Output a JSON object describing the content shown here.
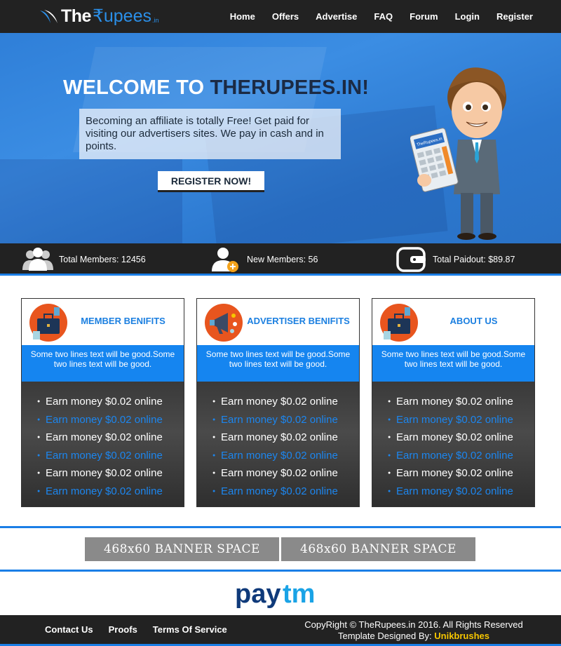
{
  "nav": {
    "logo": {
      "the": "The",
      "rupees": "₹upees",
      "in": ".in"
    },
    "items": [
      "Home",
      "Offers",
      "Advertise",
      "FAQ",
      "Forum",
      "Login",
      "Register"
    ]
  },
  "hero": {
    "title_white": "WELCOME TO ",
    "title_dark": "THERUPEES.IN!",
    "text": "Becoming an affiliate is totally Free! Get paid for visiting our advertisers sites. We pay in cash and in points.",
    "button": "REGISTER NOW!",
    "mascot_calculator_label": "TheRupees.in"
  },
  "stats": [
    {
      "icon": "members-icon",
      "label": "Total Members: 12456"
    },
    {
      "icon": "new-member-icon",
      "label": "New Members: 56"
    },
    {
      "icon": "wallet-icon",
      "label": "Total Paidout: $89.87"
    }
  ],
  "boxes": [
    {
      "title": "MEMBER BENIFITS",
      "icon": "briefcase-icon",
      "desc": "Some two lines text will be good.Some two lines text will be good.",
      "items": [
        "Earn money $0.02 online",
        "Earn money $0.02 online",
        "Earn money $0.02 online",
        "Earn money $0.02 online",
        "Earn money $0.02 online",
        "Earn money $0.02 online"
      ]
    },
    {
      "title": "ADVERTISER BENIFITS",
      "icon": "megaphone-icon",
      "desc": "Some two lines text will be good.Some two lines text will be good.",
      "items": [
        "Earn money $0.02 online",
        "Earn money $0.02 online",
        "Earn money $0.02 online",
        "Earn money $0.02 online",
        "Earn money $0.02 online",
        "Earn money $0.02 online"
      ]
    },
    {
      "title": "ABOUT US",
      "icon": "briefcase-icon",
      "desc": "Some two lines text will be good.Some two lines text will be good.",
      "items": [
        "Earn money $0.02 online",
        "Earn money $0.02 online",
        "Earn money $0.02 online",
        "Earn money $0.02 online",
        "Earn money $0.02 online",
        "Earn money $0.02 online"
      ]
    }
  ],
  "banners": [
    "468x60 BANNER SPACE",
    "468x60 BANNER SPACE"
  ],
  "paytm": {
    "pay": "pay",
    "tm": "tm"
  },
  "footer": {
    "links": [
      "Contact Us",
      "Proofs",
      "Terms Of Service"
    ],
    "copyright": "CopyRight © TheRupees.in 2016. All Rights Reserved",
    "designed_by": "Template Designed By: ",
    "designer": "Unikbrushes"
  },
  "colors": {
    "accent": "#1a7ee6",
    "dark": "#222222",
    "highlight": "#f6c600"
  }
}
